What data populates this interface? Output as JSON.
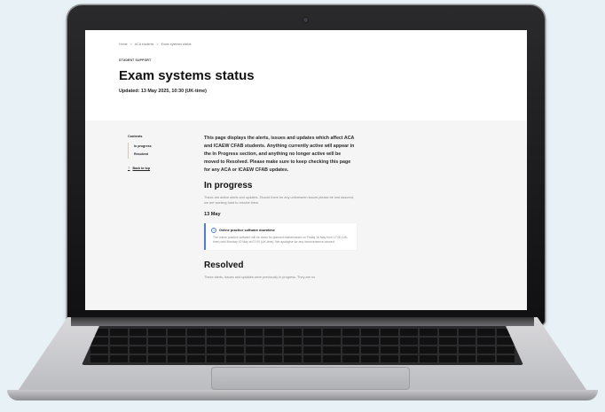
{
  "breadcrumb": [
    "Home",
    ">",
    "ACA students",
    ">",
    "Exam systems status"
  ],
  "page": {
    "eyebrow": "STUDENT SUPPORT",
    "title": "Exam systems status",
    "updated": "Updated: 13 May 2025, 10:30 (UK-time)"
  },
  "toc": {
    "title": "Contents",
    "items": [
      "In progress",
      "Resolved"
    ],
    "back_to_top": "Back to top"
  },
  "main": {
    "intro": "This page displays the alerts, issues and updates which affect ACA and ICAEW CFAB students. Anything currently active will appear in the In Progress section, and anything no longer active will be moved to Resolved. Please make sure to keep checking this page for any ACA or ICAEW CFAB updates.",
    "in_progress_heading": "In progress",
    "in_progress_text": "These are active alerts and updates. Should there be any unforeseen issues please be rest assured, we are working hard to resolve them.",
    "date_heading": "13 May",
    "alert": {
      "title": "Online practice software downtime",
      "body": "The online practice software will be down for planned maintenance on Friday 16 May from 17:00 (UK-time) until Monday 19 May at 07:00 (UK-time). We apologise for any inconvenience caused."
    },
    "resolved_heading": "Resolved",
    "resolved_text": "These alerts, issues and updates were previously in progress. They are no"
  },
  "colors": {
    "alert_accent": "#4f7fc7",
    "toc_rule": "#d7c8b2",
    "laptop_bezel": "#1a1a1c",
    "background": "#e8f2f6"
  }
}
